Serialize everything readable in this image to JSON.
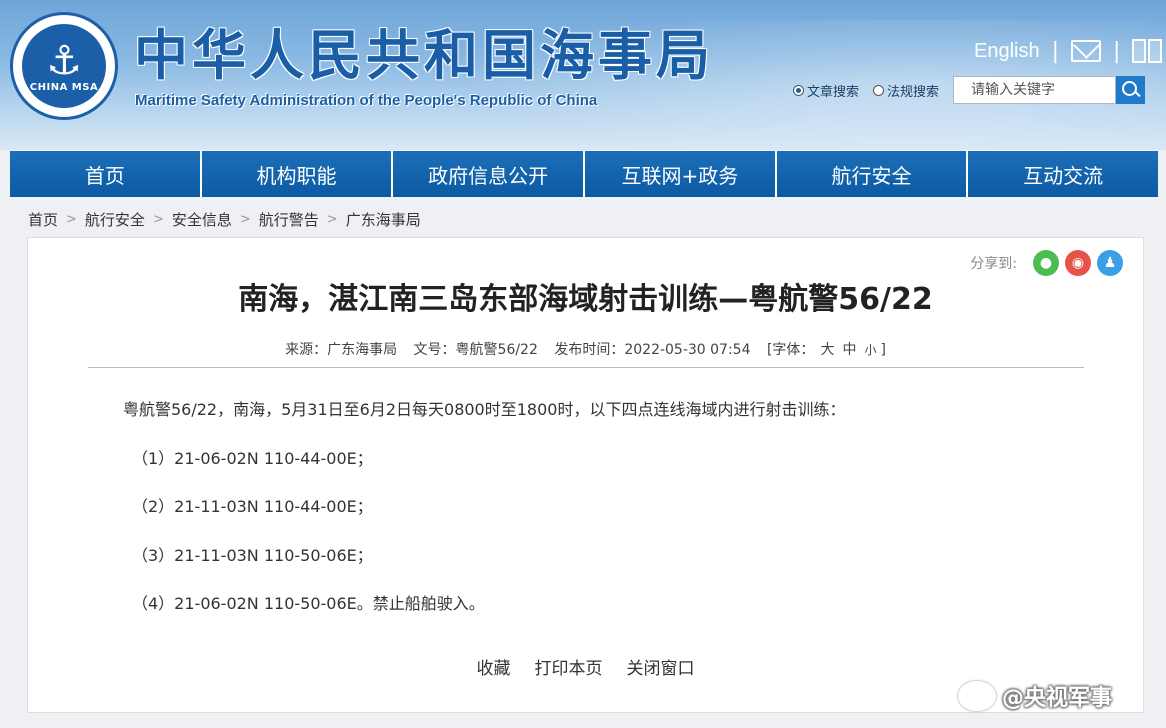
{
  "header": {
    "site_title": "中华人民共和国海事局",
    "site_subtitle": "Maritime Safety Administration of the People's Republic of China",
    "logo_text_top": "中国海事局",
    "logo_text_bottom": "CHINA MSA",
    "english_link": "English",
    "search": {
      "option_article": "文章搜索",
      "option_law": "法规搜索",
      "placeholder": "请输入关键字",
      "selected": "文章搜索"
    }
  },
  "nav": {
    "items": [
      "首页",
      "机构职能",
      "政府信息公开",
      "互联网+政务",
      "航行安全",
      "互动交流"
    ]
  },
  "breadcrumb": [
    "首页",
    "航行安全",
    "安全信息",
    "航行警告",
    "广东海事局"
  ],
  "article": {
    "share_label": "分享到:",
    "title": "南海，湛江南三岛东部海域射击训练—粤航警56/22",
    "meta": {
      "source": "来源：广东海事局",
      "doc_no": "文号：粤航警56/22",
      "published": "发布时间：2022-05-30 07:54",
      "font_label": "[字体：",
      "font_large": "大",
      "font_medium": "中",
      "font_small": "小",
      "font_close": "]"
    },
    "paragraphs": [
      "粤航警56/22，南海，5月31日至6月2日每天0800时至1800时，以下四点连线海域内进行射击训练：",
      "（1）21-06-02N 110-44-00E；",
      "（2）21-11-03N 110-44-00E；",
      "（3）21-11-03N 110-50-06E；",
      "（4）21-06-02N 110-50-06E。禁止船舶驶入。"
    ],
    "actions": [
      "收藏",
      "打印本页",
      "关闭窗口"
    ]
  },
  "watermark": "@央视军事"
}
